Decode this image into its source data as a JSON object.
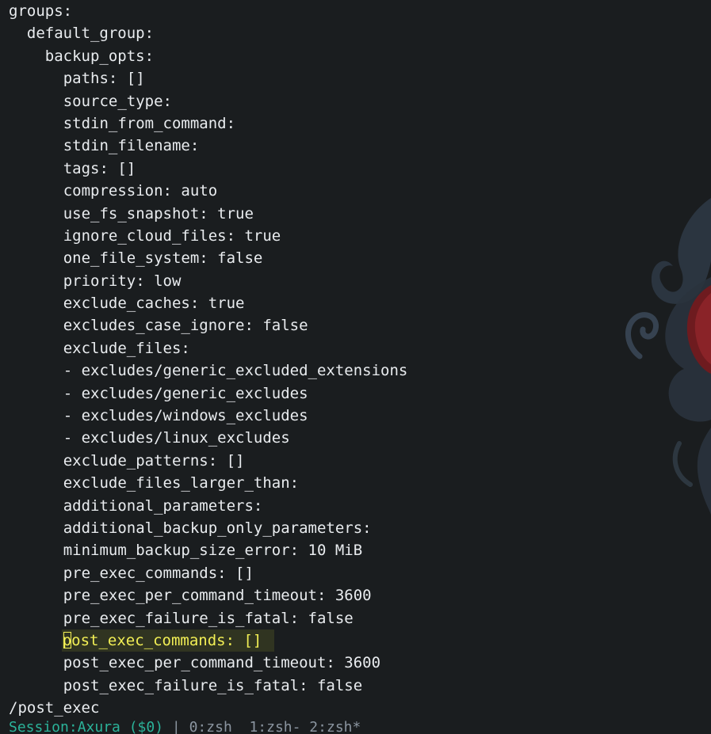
{
  "buffer": {
    "lines": [
      {
        "indent": 0,
        "text": "groups:"
      },
      {
        "indent": 1,
        "text": "default_group:"
      },
      {
        "indent": 2,
        "text": "backup_opts:"
      },
      {
        "indent": 3,
        "text": "paths: []"
      },
      {
        "indent": 3,
        "text": "source_type:"
      },
      {
        "indent": 3,
        "text": "stdin_from_command:"
      },
      {
        "indent": 3,
        "text": "stdin_filename:"
      },
      {
        "indent": 3,
        "text": "tags: []"
      },
      {
        "indent": 3,
        "text": "compression: auto"
      },
      {
        "indent": 3,
        "text": "use_fs_snapshot: true"
      },
      {
        "indent": 3,
        "text": "ignore_cloud_files: true"
      },
      {
        "indent": 3,
        "text": "one_file_system: false"
      },
      {
        "indent": 3,
        "text": "priority: low"
      },
      {
        "indent": 3,
        "text": "exclude_caches: true"
      },
      {
        "indent": 3,
        "text": "excludes_case_ignore: false"
      },
      {
        "indent": 3,
        "text": "exclude_files:"
      },
      {
        "indent": 3,
        "text": "- excludes/generic_excluded_extensions"
      },
      {
        "indent": 3,
        "text": "- excludes/generic_excludes"
      },
      {
        "indent": 3,
        "text": "- excludes/windows_excludes"
      },
      {
        "indent": 3,
        "text": "- excludes/linux_excludes"
      },
      {
        "indent": 3,
        "text": "exclude_patterns: []"
      },
      {
        "indent": 3,
        "text": "exclude_files_larger_than:"
      },
      {
        "indent": 3,
        "text": "additional_parameters:"
      },
      {
        "indent": 3,
        "text": "additional_backup_only_parameters:"
      },
      {
        "indent": 3,
        "text": "minimum_backup_size_error: 10 MiB"
      },
      {
        "indent": 3,
        "text": "pre_exec_commands: []"
      },
      {
        "indent": 3,
        "text": "pre_exec_per_command_timeout: 3600"
      },
      {
        "indent": 3,
        "text": "pre_exec_failure_is_fatal: false"
      },
      {
        "indent": 3,
        "text": "post_exec_commands: []",
        "highlight": true,
        "cursor": true
      },
      {
        "indent": 3,
        "text": "post_exec_per_command_timeout: 3600"
      },
      {
        "indent": 3,
        "text": "post_exec_failure_is_fatal: false"
      },
      {
        "indent": 0,
        "text": "/post_exec"
      }
    ]
  },
  "status_bar": {
    "session": "Session:Axura ($0)",
    "separator": " | ",
    "windows": "0:zsh  1:zsh- 2:zsh*"
  },
  "colors": {
    "background": "#1a1d1f",
    "text": "#e9ecef",
    "search_highlight_text": "#f2ef55",
    "status_session": "#2bb39a",
    "status_text": "#8b95a0",
    "wallpaper_red": "#7a1e22",
    "wallpaper_slate": "#3a4a5a"
  }
}
